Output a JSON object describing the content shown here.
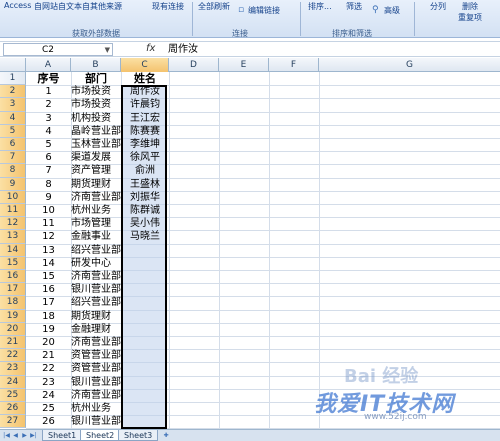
{
  "ribbon": {
    "labels": [
      "Access",
      "自网站",
      "自文本",
      "自其他来源",
      "现有连接",
      "全部刷新",
      "编辑链接",
      "排序...",
      "筛选",
      "高级",
      "分列",
      "删除",
      "重复项"
    ],
    "groups": [
      "获取外部数据",
      "连接",
      "排序和筛选"
    ]
  },
  "formula_bar": {
    "name_box": "C2",
    "fx": "fx",
    "content": "周作汝"
  },
  "columns": [
    "A",
    "B",
    "C",
    "D",
    "E",
    "F",
    "G"
  ],
  "header_row": {
    "seq": "序号",
    "dept": "部门",
    "name": "姓名"
  },
  "rows": [
    {
      "n": "1",
      "seq": "1",
      "dept": "市场投资",
      "name": "周作汝"
    },
    {
      "n": "2",
      "seq": "2",
      "dept": "市场投资",
      "name": "许晨钧"
    },
    {
      "n": "3",
      "seq": "3",
      "dept": "机构投资",
      "name": "王江宏"
    },
    {
      "n": "4",
      "seq": "4",
      "dept": "晶岭营业部",
      "name": "陈赛赛"
    },
    {
      "n": "5",
      "seq": "5",
      "dept": "玉林营业部",
      "name": "李维坤"
    },
    {
      "n": "6",
      "seq": "6",
      "dept": "渠道发展",
      "name": "徐风平"
    },
    {
      "n": "7",
      "seq": "7",
      "dept": "资产管理",
      "name": "俞洲"
    },
    {
      "n": "8",
      "seq": "8",
      "dept": "期货理财",
      "name": "王盛林"
    },
    {
      "n": "9",
      "seq": "9",
      "dept": "济南营业部",
      "name": "刘振华"
    },
    {
      "n": "10",
      "seq": "10",
      "dept": "杭州业务",
      "name": "陈群诚"
    },
    {
      "n": "11",
      "seq": "11",
      "dept": "市场管理",
      "name": "吴小伟"
    },
    {
      "n": "12",
      "seq": "12",
      "dept": "金融事业",
      "name": "马晓兰"
    },
    {
      "n": "13",
      "seq": "13",
      "dept": "绍兴营业部",
      "name": ""
    },
    {
      "n": "14",
      "seq": "14",
      "dept": "研发中心",
      "name": ""
    },
    {
      "n": "15",
      "seq": "15",
      "dept": "济南营业部",
      "name": ""
    },
    {
      "n": "16",
      "seq": "16",
      "dept": "银川营业部",
      "name": ""
    },
    {
      "n": "17",
      "seq": "17",
      "dept": "绍兴营业部",
      "name": ""
    },
    {
      "n": "18",
      "seq": "18",
      "dept": "期货理财",
      "name": ""
    },
    {
      "n": "19",
      "seq": "19",
      "dept": "金融理财",
      "name": ""
    },
    {
      "n": "20",
      "seq": "20",
      "dept": "济南营业部",
      "name": ""
    },
    {
      "n": "21",
      "seq": "21",
      "dept": "资管营业部",
      "name": ""
    },
    {
      "n": "22",
      "seq": "22",
      "dept": "资管营业部",
      "name": ""
    },
    {
      "n": "23",
      "seq": "23",
      "dept": "银川营业部",
      "name": ""
    },
    {
      "n": "24",
      "seq": "24",
      "dept": "济南营业部",
      "name": ""
    },
    {
      "n": "25",
      "seq": "25",
      "dept": "杭州业务",
      "name": ""
    },
    {
      "n": "26",
      "seq": "26",
      "dept": "银川营业部",
      "name": ""
    }
  ],
  "sheets": [
    "Sheet1",
    "Sheet2",
    "Sheet3"
  ],
  "active_sheet": "Sheet2",
  "watermark": {
    "baidu": "Bai 经验",
    "site": "我爱IT技术网",
    "url": "www.52ij.com"
  },
  "colors": {
    "selection_fill": "#bed0eb",
    "header_highlight": "#f4c36e",
    "ribbon": "#d3e1f3"
  }
}
